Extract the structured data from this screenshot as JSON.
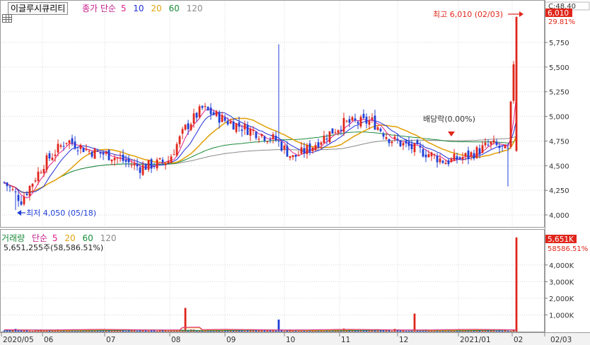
{
  "window": {
    "stock_name": "이글루시큐리티"
  },
  "indicator": {
    "label": "종가 단순",
    "periods": [
      "5",
      "10",
      "20",
      "60",
      "120"
    ],
    "period_colors": [
      "#e0218a",
      "#1f2fd6",
      "#e2a30f",
      "#1a8a3a",
      "#8a8a8a"
    ]
  },
  "price_axis": {
    "ticks": [
      "5,750",
      "5,500",
      "5,250",
      "5,000",
      "4,750",
      "4,500",
      "4,250",
      "4,000"
    ],
    "top_box": "C:48.40",
    "current": "6,010",
    "change_pct": "29.81%"
  },
  "annotations": {
    "high": "최고 6,010 (02/03)",
    "low": "최저 4,050 (05/18)",
    "dividend": "배당락(0.00%)"
  },
  "volume": {
    "label": "거래량",
    "ma_label": "단순",
    "periods": [
      "5",
      "20",
      "60",
      "120"
    ],
    "period_colors": [
      "#e0218a",
      "#e2a30f",
      "#1a8a3a",
      "#8a8a8a"
    ],
    "stat": "5,651,255주(58,586.51%)",
    "axis_ticks": [
      "4,000K",
      "3,000K",
      "2,000K",
      "1,000K"
    ],
    "current_box": "5,651K",
    "pct_box": "58586.51%"
  },
  "x_axis": {
    "labels": [
      "2020/05",
      "06",
      "07",
      "08",
      "09",
      "10",
      "11",
      "12",
      "2021/01",
      "02",
      "02/03"
    ]
  },
  "chart_data": {
    "type": "candlestick",
    "y_range": [
      3900,
      6080
    ],
    "volume_range": [
      0,
      5900
    ],
    "ma_colors": {
      "ma5": "#e0218a",
      "ma10": "#1f2fd6",
      "ma20": "#e2a30f",
      "ma60": "#1a8a3a",
      "ma120": "#8a8a8a"
    },
    "up_color": "#e0261b",
    "down_color": "#1f3fd6",
    "high_point": {
      "value": 6010,
      "date": "02/03"
    },
    "low_point": {
      "value": 4050,
      "date": "05/18"
    },
    "last_close": 6010,
    "last_volume_k": 5651,
    "month_boundaries": [
      "2020/05",
      "06",
      "07",
      "08",
      "09",
      "10",
      "11",
      "12",
      "2021/01",
      "02"
    ]
  }
}
